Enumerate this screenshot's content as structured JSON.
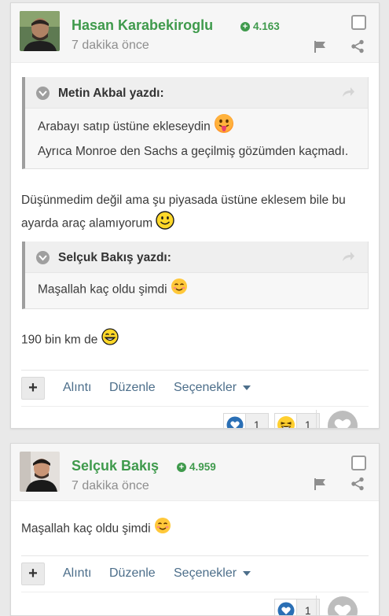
{
  "posts": [
    {
      "author": "Hasan Karabekiroglu",
      "points": "4.163",
      "time": "7 dakika önce",
      "quotes": [
        {
          "author": "Metin Akbal yazdı:",
          "line1": "Arabayı satıp üstüne ekleseydin",
          "line2": "Ayrıca Monroe den Sachs a geçilmiş gözümden kaçmadı."
        },
        {
          "author": "Selçuk Bakış yazdı:",
          "line1": "Maşallah kaç oldu şimdi"
        }
      ],
      "text1": "Düşünmedim değil ama şu piyasada üstüne eklesem bile bu ayarda araç alamıyorum",
      "text2": "190 bin km de",
      "actions": {
        "quote": "Alıntı",
        "edit": "Düzenle",
        "options": "Seçenekler"
      },
      "reactions": [
        {
          "icon": "heart-icon",
          "count": "1"
        },
        {
          "icon": "laugh-emoji-icon",
          "count": "1"
        }
      ]
    },
    {
      "author": "Selçuk Bakış",
      "points": "4.959",
      "time": "7 dakika önce",
      "text1": "Maşallah kaç oldu şimdi",
      "actions": {
        "quote": "Alıntı",
        "edit": "Düzenle",
        "options": "Seçenekler"
      },
      "reactions": [
        {
          "icon": "heart-icon",
          "count": "1"
        }
      ]
    }
  ],
  "colors": {
    "author_green": "#3f9a4c",
    "link_blue": "#4c6e8a",
    "heart_blue": "#2a6fb5"
  }
}
